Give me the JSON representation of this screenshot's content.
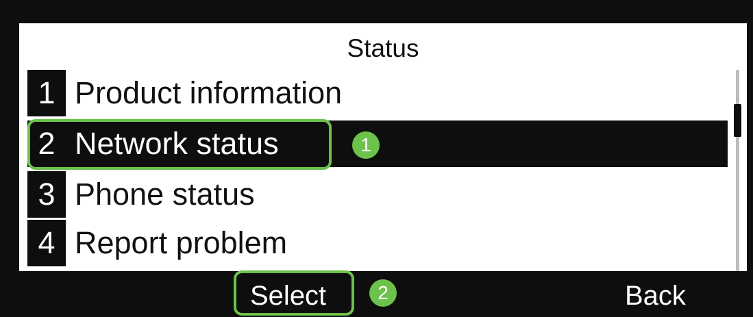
{
  "screen": {
    "title": "Status",
    "menu_items": [
      {
        "number": "1",
        "label": "Product information"
      },
      {
        "number": "2",
        "label": "Network status"
      },
      {
        "number": "3",
        "label": "Phone status"
      },
      {
        "number": "4",
        "label": "Report problem"
      }
    ],
    "selected_index": 2
  },
  "softkeys": {
    "select_label": "Select",
    "back_label": "Back"
  },
  "callouts": {
    "first": "1",
    "second": "2"
  },
  "colors": {
    "screen_background": "#ffffff",
    "bezel": "#0e0e0e",
    "selection_highlight": "#0e0e0e",
    "callout_green": "#6cc24a"
  }
}
